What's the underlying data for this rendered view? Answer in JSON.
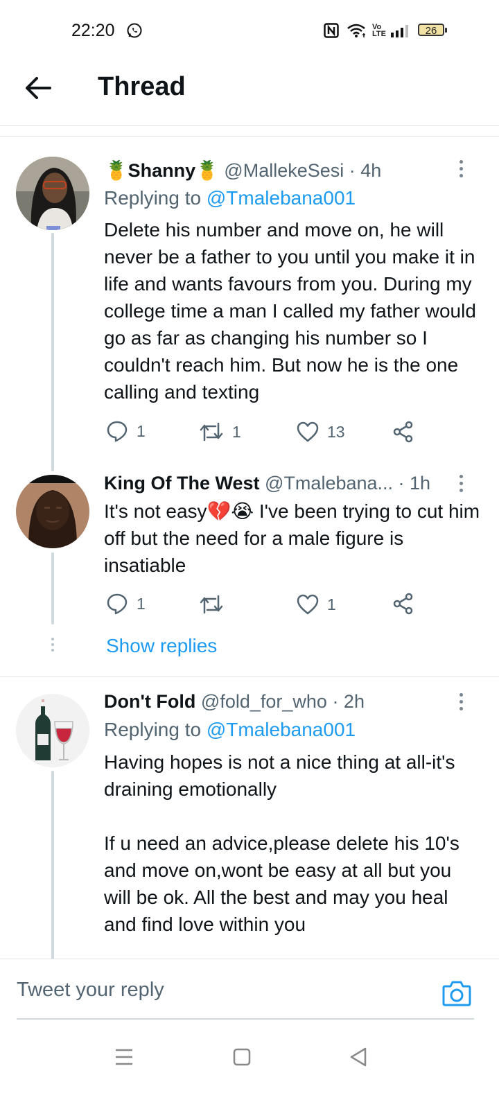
{
  "status_bar": {
    "time": "22:20",
    "battery": "26",
    "icons": [
      "whatsapp-icon",
      "nfc-icon",
      "wifi-icon",
      "volte-icon",
      "signal-icon",
      "battery-icon"
    ]
  },
  "header": {
    "title": "Thread",
    "back_icon": "back-arrow-icon"
  },
  "tweets": [
    {
      "name": "Shanny",
      "name_emoji": "🍍",
      "handle": "@MallekeSesi",
      "time": "· 4h",
      "replying_label": "Replying to",
      "replying_handle": "@Tmalebana001",
      "text": "Delete his number and move on, he will never be a father to you until you make it in life and wants favours from you. During my college time a man I called my father would go as far as changing his number so I couldn't reach him. But now he is the one calling and texting",
      "replies": "1",
      "retweets": "1",
      "likes": "13"
    },
    {
      "name": "King Of The West",
      "handle": "@Tmalebana...",
      "time": "· 1h",
      "text_before": "It's not easy",
      "emojis": "💔😭",
      "text_after": " I've been trying to cut him off but the need for a male figure is insatiable",
      "replies": "1",
      "retweets": "",
      "likes": "1",
      "show_replies": "Show replies"
    },
    {
      "name": "Don't Fold",
      "handle": "@fold_for_who",
      "time": "· 2h",
      "replying_label": "Replying to",
      "replying_handle": "@Tmalebana001",
      "text": "Having hopes is not a nice thing at all-it's draining emotionally\n\nIf u need an advice,please delete his 10's and move on,wont be easy at all but you will be ok. All the best and may you heal and find love within you"
    }
  ],
  "reply_bar": {
    "placeholder": "Tweet your reply",
    "camera_icon": "camera-icon"
  },
  "nav_bar": {
    "icons": [
      "menu-icon",
      "home-square-icon",
      "back-triangle-icon"
    ]
  },
  "colors": {
    "accent": "#1d9bf0",
    "text": "#0f1419",
    "secondary": "#536471",
    "thread_line": "#cfd9de"
  }
}
